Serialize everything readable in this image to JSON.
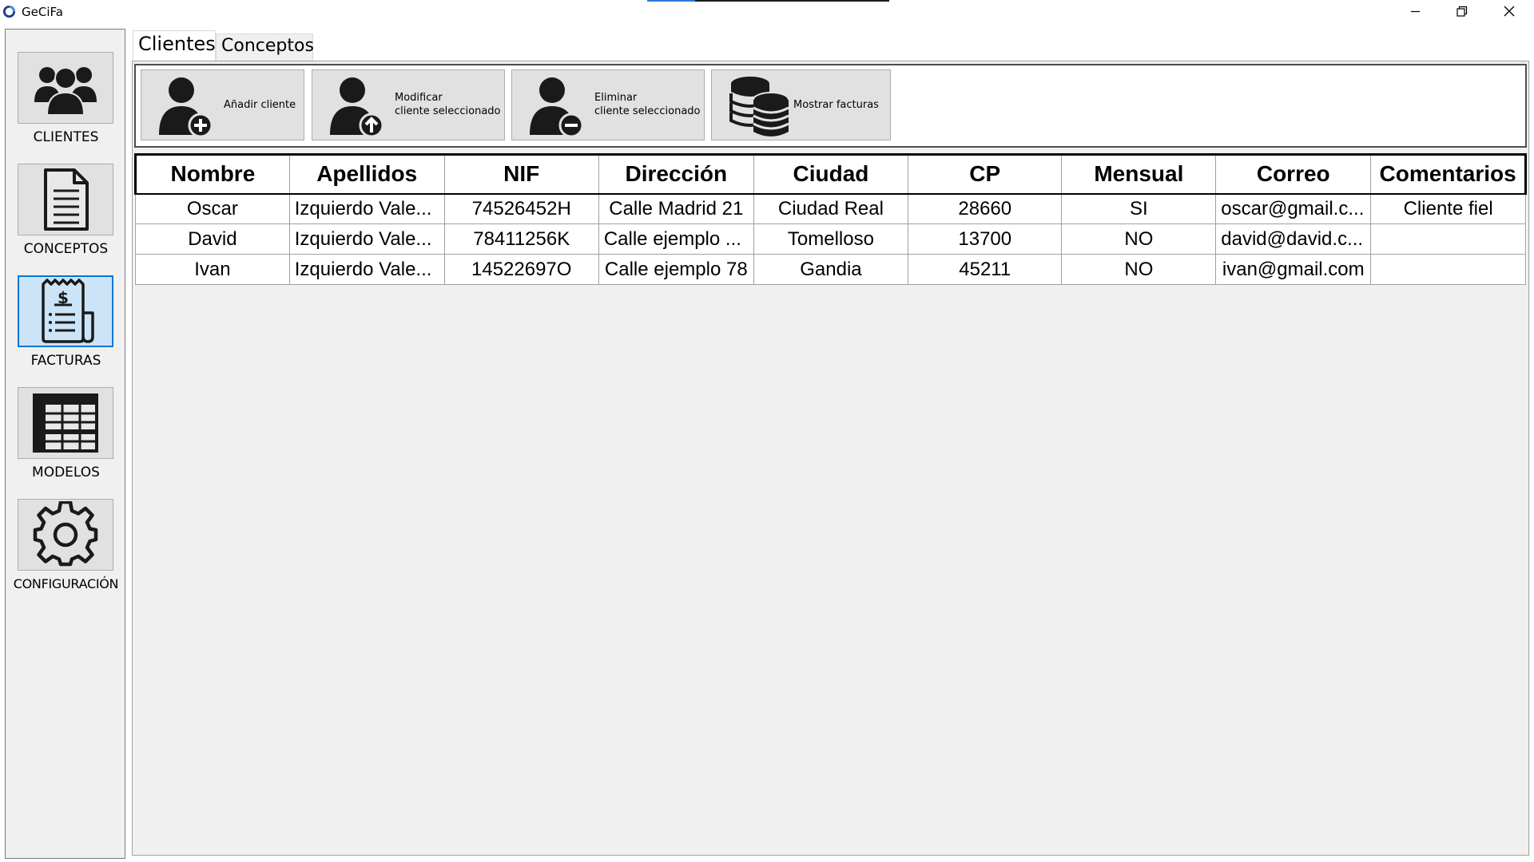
{
  "window": {
    "title": "GeCiFa",
    "controls": [
      "minimize-icon",
      "restore-icon",
      "close-icon"
    ]
  },
  "sidebar": {
    "items": [
      {
        "label": "CLIENTES",
        "icon": "users-icon",
        "selected": false
      },
      {
        "label": "CONCEPTOS",
        "icon": "document-icon",
        "selected": false
      },
      {
        "label": "FACTURAS",
        "icon": "invoice-icon",
        "selected": true
      },
      {
        "label": "MODELOS",
        "icon": "table-icon",
        "selected": false
      },
      {
        "label": "CONFIGURACIÓN",
        "icon": "gear-icon",
        "selected": false
      }
    ]
  },
  "tabs": [
    {
      "label": "Clientes",
      "active": true
    },
    {
      "label": "Conceptos",
      "active": false
    }
  ],
  "toolbar": {
    "add_label": "Añadir cliente",
    "modify_label": "Modificar\ncliente seleccionado",
    "delete_label": "Eliminar\ncliente seleccionado",
    "invoices_label": "Mostrar facturas"
  },
  "table": {
    "columns": [
      "Nombre",
      "Apellidos",
      "NIF",
      "Dirección",
      "Ciudad",
      "CP",
      "Mensual",
      "Correo",
      "Comentarios"
    ],
    "rows": [
      [
        "Oscar",
        "Izquierdo Vale...",
        "74526452H",
        "Calle Madrid 21",
        "Ciudad Real",
        "28660",
        "SI",
        "oscar@gmail.c...",
        "Cliente fiel"
      ],
      [
        "David",
        "Izquierdo Vale...",
        "78411256K",
        "Calle ejemplo ...",
        "Tomelloso",
        "13700",
        "NO",
        "david@david.c...",
        ""
      ],
      [
        "Ivan",
        "Izquierdo Vale...",
        "14522697O",
        "Calle ejemplo 78",
        "Gandia",
        "45211",
        "NO",
        "ivan@gmail.com",
        ""
      ]
    ]
  },
  "colors": {
    "accent": "#0078d7",
    "button_face": "#e1e1e1",
    "panel_bg": "#f0f0f0"
  }
}
